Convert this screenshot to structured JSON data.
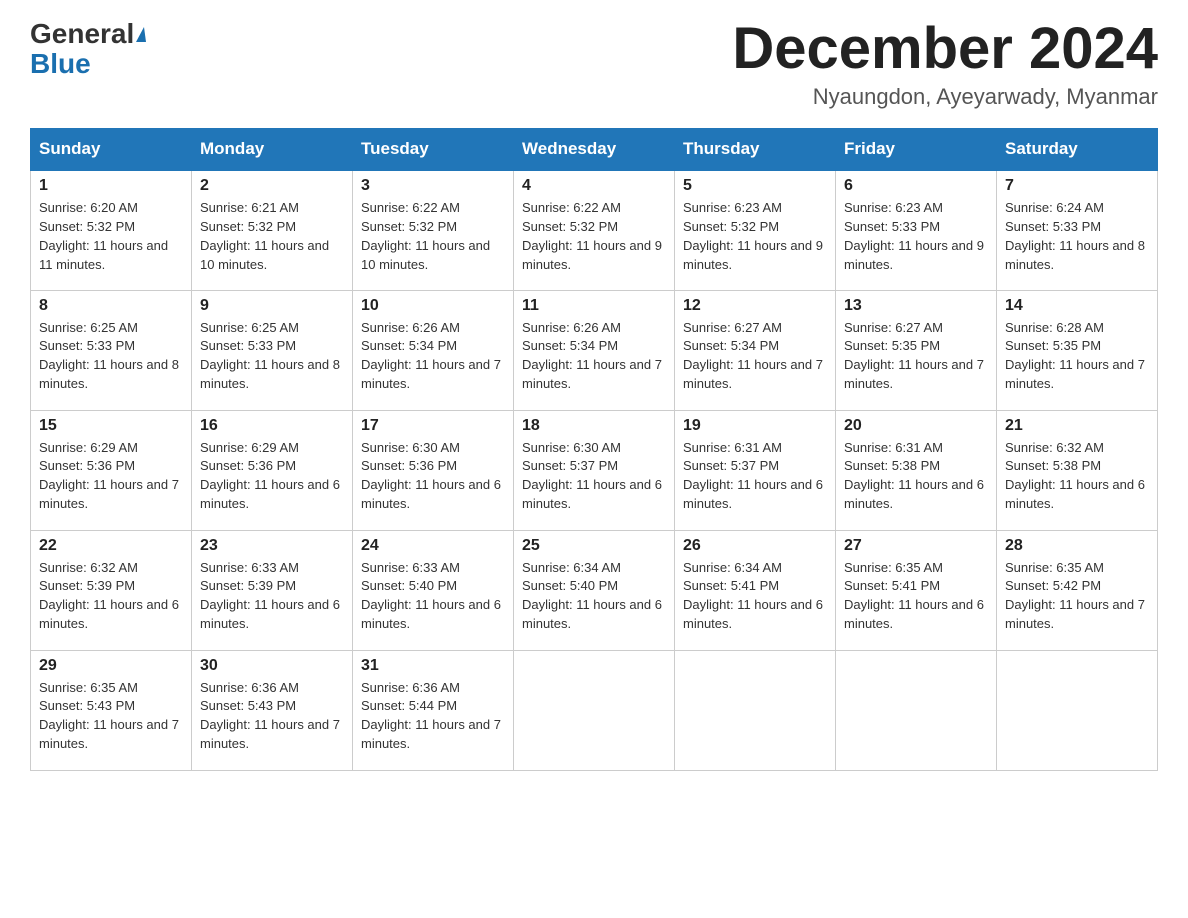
{
  "header": {
    "logo_line1": "General",
    "logo_line2": "Blue",
    "month_title": "December 2024",
    "subtitle": "Nyaungdon, Ayeyarwady, Myanmar"
  },
  "days_of_week": [
    "Sunday",
    "Monday",
    "Tuesday",
    "Wednesday",
    "Thursday",
    "Friday",
    "Saturday"
  ],
  "weeks": [
    [
      {
        "day": "1",
        "sunrise": "6:20 AM",
        "sunset": "5:32 PM",
        "daylight": "11 hours and 11 minutes."
      },
      {
        "day": "2",
        "sunrise": "6:21 AM",
        "sunset": "5:32 PM",
        "daylight": "11 hours and 10 minutes."
      },
      {
        "day": "3",
        "sunrise": "6:22 AM",
        "sunset": "5:32 PM",
        "daylight": "11 hours and 10 minutes."
      },
      {
        "day": "4",
        "sunrise": "6:22 AM",
        "sunset": "5:32 PM",
        "daylight": "11 hours and 9 minutes."
      },
      {
        "day": "5",
        "sunrise": "6:23 AM",
        "sunset": "5:32 PM",
        "daylight": "11 hours and 9 minutes."
      },
      {
        "day": "6",
        "sunrise": "6:23 AM",
        "sunset": "5:33 PM",
        "daylight": "11 hours and 9 minutes."
      },
      {
        "day": "7",
        "sunrise": "6:24 AM",
        "sunset": "5:33 PM",
        "daylight": "11 hours and 8 minutes."
      }
    ],
    [
      {
        "day": "8",
        "sunrise": "6:25 AM",
        "sunset": "5:33 PM",
        "daylight": "11 hours and 8 minutes."
      },
      {
        "day": "9",
        "sunrise": "6:25 AM",
        "sunset": "5:33 PM",
        "daylight": "11 hours and 8 minutes."
      },
      {
        "day": "10",
        "sunrise": "6:26 AM",
        "sunset": "5:34 PM",
        "daylight": "11 hours and 7 minutes."
      },
      {
        "day": "11",
        "sunrise": "6:26 AM",
        "sunset": "5:34 PM",
        "daylight": "11 hours and 7 minutes."
      },
      {
        "day": "12",
        "sunrise": "6:27 AM",
        "sunset": "5:34 PM",
        "daylight": "11 hours and 7 minutes."
      },
      {
        "day": "13",
        "sunrise": "6:27 AM",
        "sunset": "5:35 PM",
        "daylight": "11 hours and 7 minutes."
      },
      {
        "day": "14",
        "sunrise": "6:28 AM",
        "sunset": "5:35 PM",
        "daylight": "11 hours and 7 minutes."
      }
    ],
    [
      {
        "day": "15",
        "sunrise": "6:29 AM",
        "sunset": "5:36 PM",
        "daylight": "11 hours and 7 minutes."
      },
      {
        "day": "16",
        "sunrise": "6:29 AM",
        "sunset": "5:36 PM",
        "daylight": "11 hours and 6 minutes."
      },
      {
        "day": "17",
        "sunrise": "6:30 AM",
        "sunset": "5:36 PM",
        "daylight": "11 hours and 6 minutes."
      },
      {
        "day": "18",
        "sunrise": "6:30 AM",
        "sunset": "5:37 PM",
        "daylight": "11 hours and 6 minutes."
      },
      {
        "day": "19",
        "sunrise": "6:31 AM",
        "sunset": "5:37 PM",
        "daylight": "11 hours and 6 minutes."
      },
      {
        "day": "20",
        "sunrise": "6:31 AM",
        "sunset": "5:38 PM",
        "daylight": "11 hours and 6 minutes."
      },
      {
        "day": "21",
        "sunrise": "6:32 AM",
        "sunset": "5:38 PM",
        "daylight": "11 hours and 6 minutes."
      }
    ],
    [
      {
        "day": "22",
        "sunrise": "6:32 AM",
        "sunset": "5:39 PM",
        "daylight": "11 hours and 6 minutes."
      },
      {
        "day": "23",
        "sunrise": "6:33 AM",
        "sunset": "5:39 PM",
        "daylight": "11 hours and 6 minutes."
      },
      {
        "day": "24",
        "sunrise": "6:33 AM",
        "sunset": "5:40 PM",
        "daylight": "11 hours and 6 minutes."
      },
      {
        "day": "25",
        "sunrise": "6:34 AM",
        "sunset": "5:40 PM",
        "daylight": "11 hours and 6 minutes."
      },
      {
        "day": "26",
        "sunrise": "6:34 AM",
        "sunset": "5:41 PM",
        "daylight": "11 hours and 6 minutes."
      },
      {
        "day": "27",
        "sunrise": "6:35 AM",
        "sunset": "5:41 PM",
        "daylight": "11 hours and 6 minutes."
      },
      {
        "day": "28",
        "sunrise": "6:35 AM",
        "sunset": "5:42 PM",
        "daylight": "11 hours and 7 minutes."
      }
    ],
    [
      {
        "day": "29",
        "sunrise": "6:35 AM",
        "sunset": "5:43 PM",
        "daylight": "11 hours and 7 minutes."
      },
      {
        "day": "30",
        "sunrise": "6:36 AM",
        "sunset": "5:43 PM",
        "daylight": "11 hours and 7 minutes."
      },
      {
        "day": "31",
        "sunrise": "6:36 AM",
        "sunset": "5:44 PM",
        "daylight": "11 hours and 7 minutes."
      },
      null,
      null,
      null,
      null
    ]
  ]
}
